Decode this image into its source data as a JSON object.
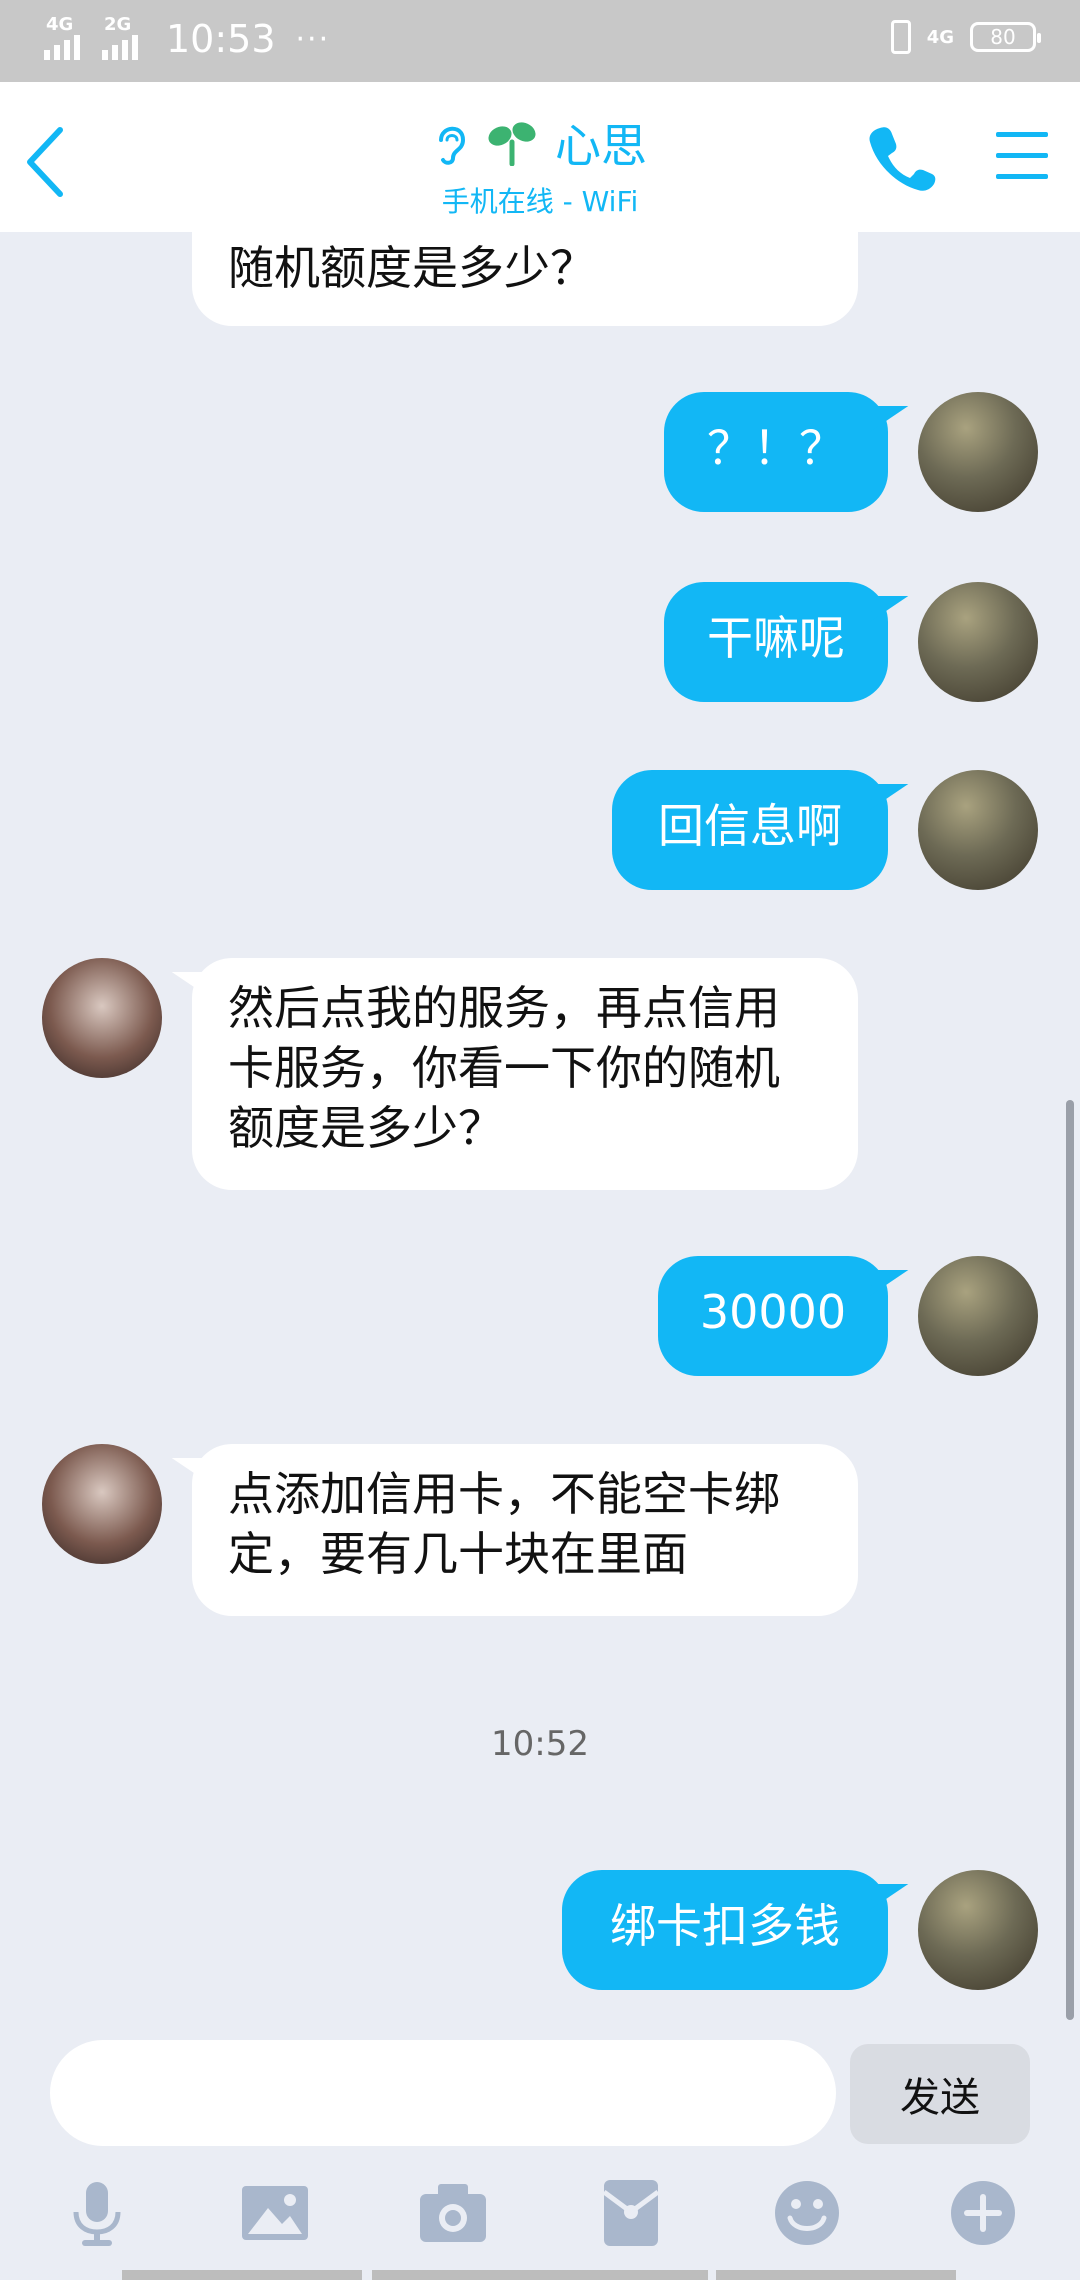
{
  "status_bar": {
    "network1": "4G",
    "network2": "2G",
    "time": "10:53",
    "more": "···",
    "network_right": "4G",
    "battery": "80"
  },
  "header": {
    "title": "心思",
    "subtitle": "手机在线 - WiFi"
  },
  "messages": {
    "m0": "随机额度是多少？",
    "m1": "？！？",
    "m2": "干嘛呢",
    "m3": "回信息啊",
    "m4": "然后点我的服务，再点信用卡服务，你看一下你的随机额度是多少？",
    "m5": "30000",
    "m6": "点添加信用卡，不能空卡绑定，要有几十块在里面",
    "timestamp": "10:52",
    "m7": "绑卡扣多钱"
  },
  "composer": {
    "placeholder": "",
    "send_label": "发送"
  },
  "colors": {
    "accent": "#12b7f5",
    "background": "#eaedf4",
    "status_bar": "#c8c8c8",
    "tool_icon": "#a9b7cc"
  }
}
